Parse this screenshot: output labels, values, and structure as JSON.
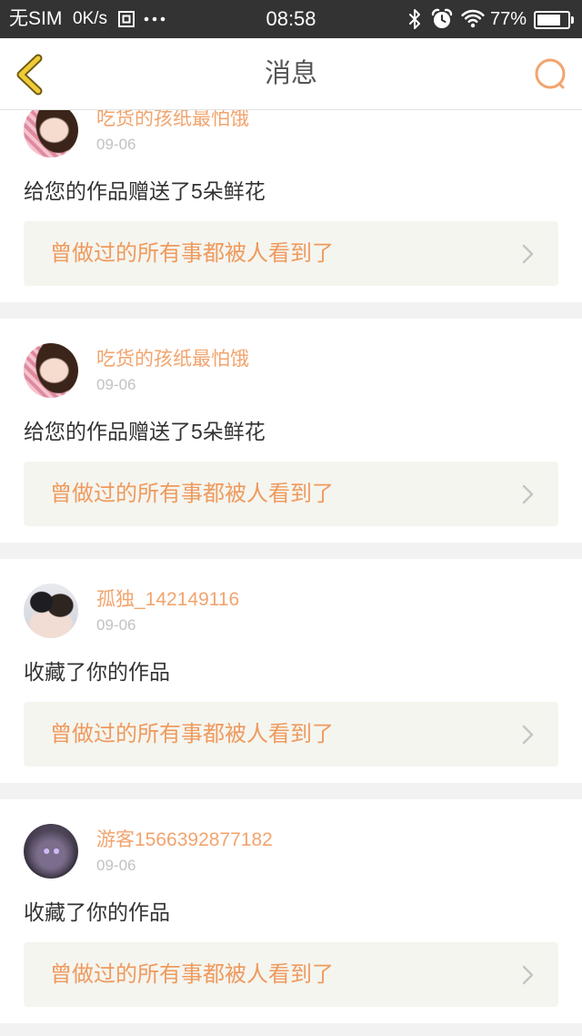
{
  "status_bar": {
    "carrier": "无SIM",
    "net_speed": "0K/s",
    "time": "08:58",
    "battery_label": "77%",
    "battery_level": 0.77,
    "icons": {
      "notification": "app-notification-icon",
      "more": "more-dots-icon",
      "bluetooth": "bluetooth-icon",
      "alarm": "alarm-icon",
      "wifi": "wifi-icon",
      "battery": "battery-icon"
    }
  },
  "header": {
    "title": "消息",
    "back_icon": "back-chevron-icon",
    "search_icon": "search-icon"
  },
  "theme": {
    "accent": "#f2a46e",
    "work_title_color": "#ef9a5e",
    "back_icon_color": "#f0cb38",
    "card_background": "#ffffff",
    "separator_background": "#f2f2f2",
    "work_box_background": "#f5f5ef",
    "date_color": "#c2c2c2",
    "text_color": "#333333"
  },
  "messages": [
    {
      "user_name": "吃货的孩纸最怕饿",
      "date": "09-06",
      "action": "给您的作品赠送了5朵鲜花",
      "work_title": "曾做过的所有事都被人看到了"
    },
    {
      "user_name": "吃货的孩纸最怕饿",
      "date": "09-06",
      "action": "给您的作品赠送了5朵鲜花",
      "work_title": "曾做过的所有事都被人看到了"
    },
    {
      "user_name": "孤独_142149116",
      "date": "09-06",
      "action": "收藏了你的作品",
      "work_title": "曾做过的所有事都被人看到了"
    },
    {
      "user_name": "游客1566392877182",
      "date": "09-06",
      "action": "收藏了你的作品",
      "work_title": "曾做过的所有事都被人看到了"
    }
  ]
}
